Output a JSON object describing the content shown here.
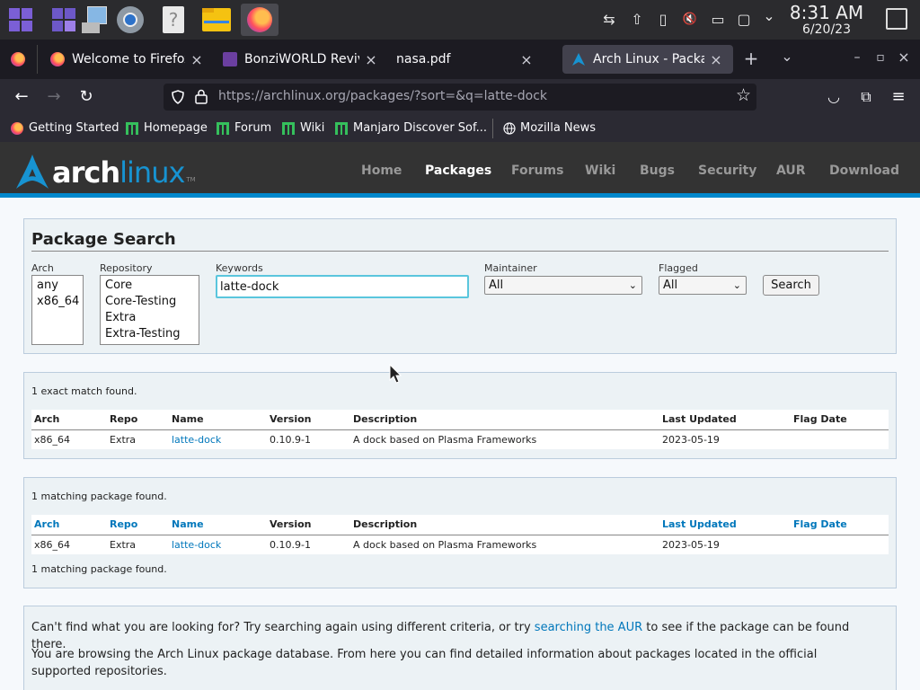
{
  "taskbar": {
    "clock_time": "8:31 AM",
    "clock_date": "6/20/23",
    "apps": [
      {
        "name": "pager-desktop-1-icon"
      },
      {
        "name": "pager-desktop-2-icon"
      },
      {
        "name": "pager-desktop-3-icon"
      },
      {
        "name": "system-settings-icon"
      },
      {
        "name": "help-icon"
      },
      {
        "name": "files-icon"
      },
      {
        "name": "firefox-icon"
      }
    ],
    "tray_glyphs": {
      "network": "⇆",
      "update": "⇧",
      "clipboard": "▯",
      "mute": "🔇",
      "battery": "▭",
      "display": "▢",
      "expand": "⌄"
    },
    "help_glyph": "?"
  },
  "browser": {
    "tabs": [
      {
        "title": "Welcome to Firefox",
        "close": "×"
      },
      {
        "title": "BonziWORLD Revived",
        "close": "×"
      },
      {
        "title": "nasa.pdf",
        "close": "×"
      },
      {
        "title": "Arch Linux - Package",
        "close": "×"
      }
    ],
    "new_tab": "+",
    "list_tabs": "⌄",
    "win_min": "–",
    "win_max": "▫",
    "win_close": "×",
    "back": "←",
    "forward": "→",
    "reload": "↻",
    "url_host": "https://archlinux.org",
    "url_path": "/packages/?sort=&q=latte-dock",
    "star": "☆",
    "pocket": "◡",
    "extensions": "⧉",
    "menu": "≡",
    "bookmarks": [
      {
        "label": "Getting Started"
      },
      {
        "label": "Homepage"
      },
      {
        "label": "Forum"
      },
      {
        "label": "Wiki"
      },
      {
        "label": "Manjaro Discover Sof..."
      },
      {
        "label": "Mozilla News"
      }
    ]
  },
  "site": {
    "logo_arch": "arch",
    "logo_linux": "linux",
    "logo_tm": "TM",
    "nav": [
      "Home",
      "Packages",
      "Forums",
      "Wiki",
      "Bugs",
      "Security",
      "AUR",
      "Download"
    ]
  },
  "search": {
    "title": "Package Search",
    "arch_label": "Arch",
    "arch_options": [
      "any",
      "x86_64"
    ],
    "repo_label": "Repository",
    "repo_options": [
      "Core",
      "Core-Testing",
      "Extra",
      "Extra-Testing"
    ],
    "keywords_label": "Keywords",
    "keywords_value": "latte-dock",
    "maintainer_label": "Maintainer",
    "maintainer_value": "All",
    "flagged_label": "Flagged",
    "flagged_value": "All",
    "chevron": "⌄",
    "button": "Search"
  },
  "exact": {
    "count_text": "1 exact match found.",
    "headers": [
      "Arch",
      "Repo",
      "Name",
      "Version",
      "Description",
      "Last Updated",
      "Flag Date"
    ],
    "rows": [
      {
        "arch": "x86_64",
        "repo": "Extra",
        "name": "latte-dock",
        "version": "0.10.9-1",
        "description": "A dock based on Plasma Frameworks",
        "updated": "2023-05-19",
        "flag": ""
      }
    ]
  },
  "matching": {
    "count_text": "1 matching package found.",
    "headers": [
      "Arch",
      "Repo",
      "Name",
      "Version",
      "Description",
      "Last Updated",
      "Flag Date"
    ],
    "rows": [
      {
        "arch": "x86_64",
        "repo": "Extra",
        "name": "latte-dock",
        "version": "0.10.9-1",
        "description": "A dock based on Plasma Frameworks",
        "updated": "2023-05-19",
        "flag": ""
      }
    ],
    "footer_count": "1 matching package found."
  },
  "info": {
    "p1_a": "Can't find what you are looking for? Try searching again using different criteria, or try ",
    "p1_link": "searching the AUR",
    "p1_b": " to see if the package can be found there.",
    "p2": "You are browsing the Arch Linux package database. From here you can find detailed information about packages located in the official supported repositories."
  },
  "colors": {
    "accent": "#1793d1",
    "link": "#0077bb",
    "header_bg": "#333333",
    "focus": "#5ac6dd"
  }
}
